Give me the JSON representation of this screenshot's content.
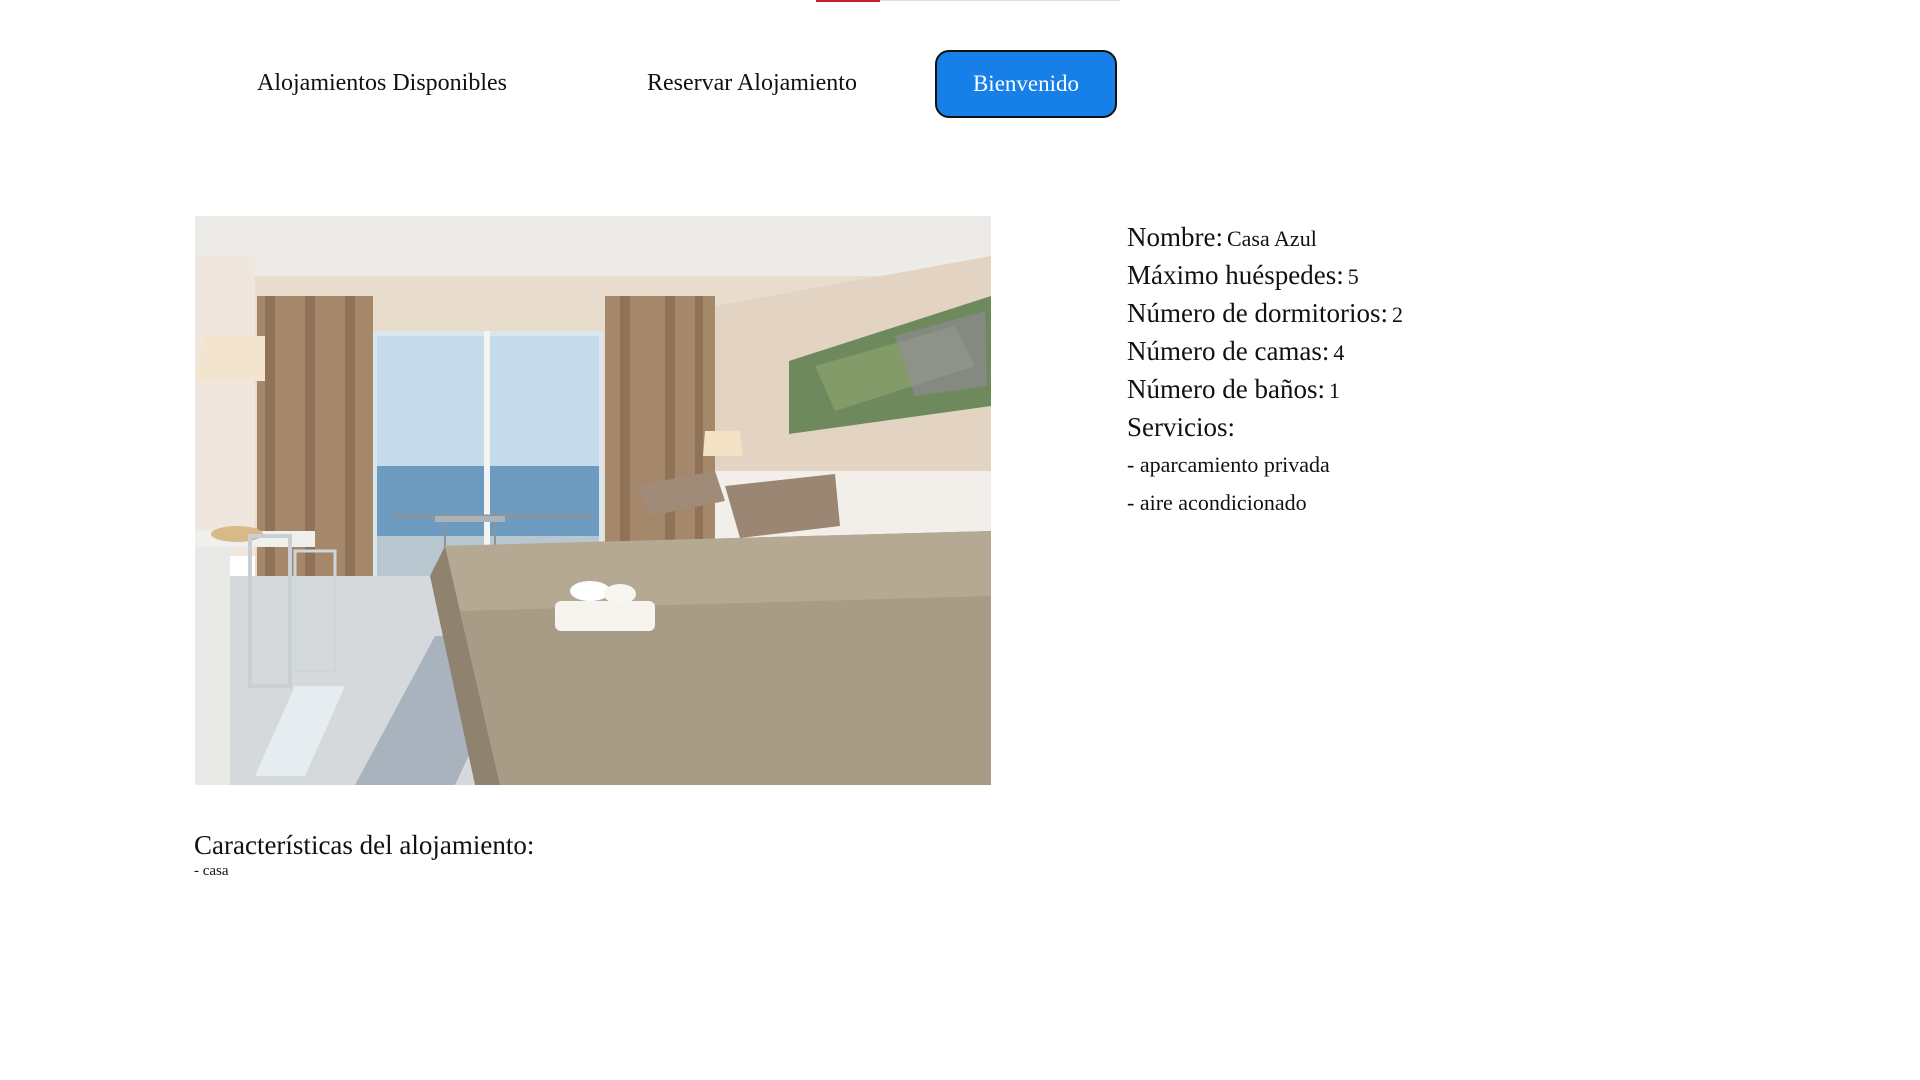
{
  "nav": {
    "link1": "Alojamientos Disponibles",
    "link2": "Reservar Alojamiento",
    "button": "Bienvenido"
  },
  "colors": {
    "accent_button": "#1680e8",
    "top_accent": "#c81e2a"
  },
  "details": {
    "nombre_label": "Nombre:",
    "nombre_value": "Casa Azul",
    "huespedes_label": "Máximo huéspedes:",
    "huespedes_value": "5",
    "dormitorios_label": "Número de dormitorios:",
    "dormitorios_value": "2",
    "camas_label": "Número de camas:",
    "camas_value": "4",
    "banos_label": "Número de baños:",
    "banos_value": "1",
    "servicios_label": "Servicios:",
    "servicios": [
      "- aparcamiento privada",
      "- aire acondicionado"
    ]
  },
  "features": {
    "title": "Características del alojamiento:",
    "items": [
      "- casa"
    ]
  }
}
